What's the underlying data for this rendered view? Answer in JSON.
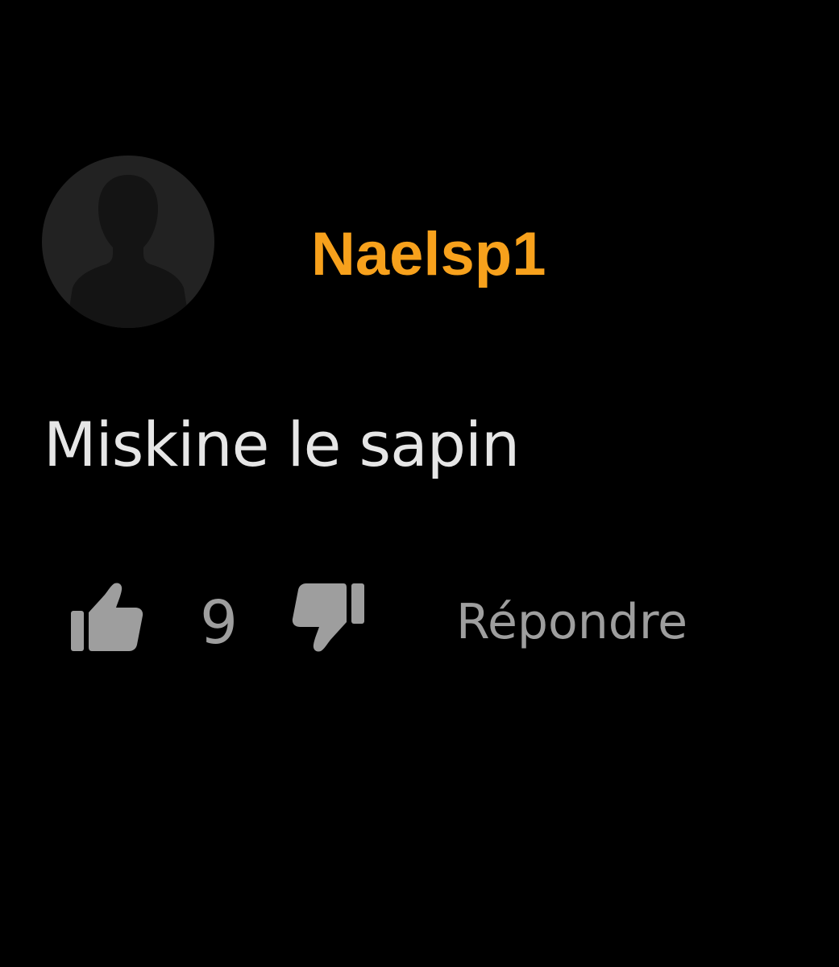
{
  "comment": {
    "author": "Naelsp1",
    "text": "Miskine le sapin",
    "like_count": "9",
    "reply_label": "Répondre",
    "avatar_icon": "default-user-silhouette-icon",
    "like_icon": "thumbs-up-icon",
    "dislike_icon": "thumbs-down-icon"
  },
  "colors": {
    "background": "#000000",
    "author": "#F7A11C",
    "text": "#E6E6E6",
    "muted": "#9E9E9E",
    "avatar_bg": "#222222",
    "avatar_figure": "#111111"
  }
}
